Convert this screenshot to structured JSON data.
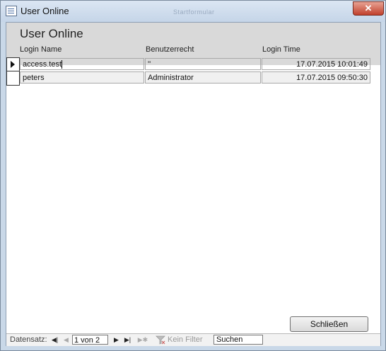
{
  "window": {
    "title": "User Online",
    "ghost_title": "Startformular",
    "close_glyph": "✕"
  },
  "form": {
    "title": "User Online",
    "columns": [
      "Login Name",
      "Benutzerrecht",
      "Login Time"
    ],
    "rows": [
      {
        "login_name": "access.test",
        "benutzerrecht": "''",
        "login_time": "17.07.2015 10:01:49"
      },
      {
        "login_name": "peters",
        "benutzerrecht": "Administrator",
        "login_time": "17.07.2015 09:50:30"
      }
    ],
    "close_label": "Schließen"
  },
  "navigation": {
    "label": "Datensatz:",
    "first": "◀|",
    "prev": "◀",
    "record": "1 von 2",
    "next": "▶",
    "last": "▶|",
    "new": "▶✱",
    "filter_label": "Kein Filter",
    "search_placeholder": "Suchen"
  },
  "colors": {
    "titlebar": "#c5d5e8",
    "header": "#d9d9d9",
    "close_button": "#c0402c"
  }
}
